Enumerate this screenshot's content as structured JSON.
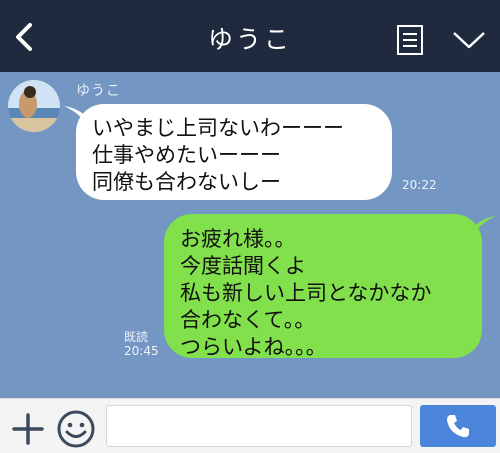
{
  "header": {
    "title": "ゆうこ",
    "icons": {
      "back": "chevron-left-icon",
      "notes": "notes-icon",
      "menu": "chevron-down-icon"
    }
  },
  "colors": {
    "header_bg": "#1f2a3e",
    "chat_bg": "#7396c3",
    "incoming_bubble": "#ffffff",
    "outgoing_bubble": "#82e04c",
    "call_button": "#4c86dc"
  },
  "messages": {
    "incoming": {
      "sender": "ゆうこ",
      "lines": [
        "いやまじ上司ないわーーー",
        "仕事やめたいーーー",
        "同僚も合わないしー"
      ],
      "time": "20:22"
    },
    "outgoing": {
      "lines": [
        "お疲れ様。。",
        "今度話聞くよ",
        "私も新しい上司となかなか",
        "合わなくて。。",
        "つらいよね。。。"
      ],
      "read_label": "既読",
      "time": "20:45"
    }
  },
  "input_bar": {
    "placeholder": "",
    "icons": {
      "add": "plus-icon",
      "sticker": "smile-icon",
      "call": "phone-icon"
    }
  }
}
